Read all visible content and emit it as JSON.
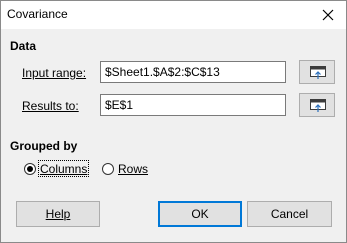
{
  "window": {
    "title": "Covariance"
  },
  "data_section": {
    "heading": "Data",
    "input_range_label": "Input range:",
    "input_range_value": "$Sheet1.$A$2:$C$13",
    "results_to_label": "Results to:",
    "results_to_value": "$E$1"
  },
  "grouped_by": {
    "heading": "Grouped by",
    "options": [
      {
        "label": "Columns",
        "selected": true
      },
      {
        "label": "Rows",
        "selected": false
      }
    ]
  },
  "buttons": {
    "help": "Help",
    "ok": "OK",
    "cancel": "Cancel"
  },
  "icons": {
    "close": "close-icon",
    "shrink": "shrink-dialog-icon"
  }
}
